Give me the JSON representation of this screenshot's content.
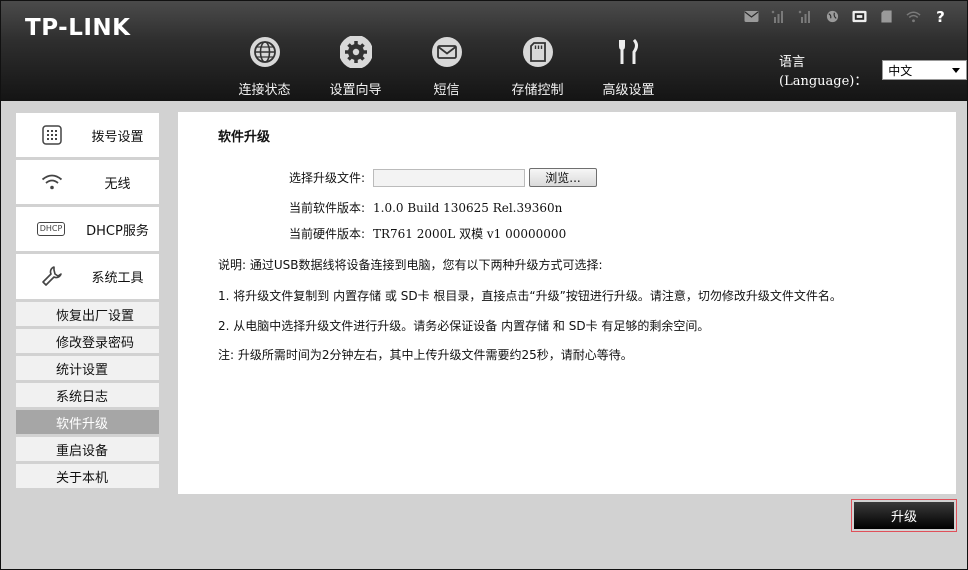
{
  "header": {
    "logo": "TP-LINK",
    "status_icons": [
      "mail-icon",
      "signal-icon",
      "signal-icon",
      "globe-icon",
      "sim-icon",
      "sd-card-icon",
      "wifi-icon",
      "help-icon"
    ],
    "help_glyph": "?",
    "nav": [
      {
        "label": "连接状态",
        "icon": "globe-icon"
      },
      {
        "label": "设置向导",
        "icon": "gear-icon"
      },
      {
        "label": "短信",
        "icon": "envelope-icon"
      },
      {
        "label": "存储控制",
        "icon": "sd-card-icon"
      },
      {
        "label": "高级设置",
        "icon": "tools-icon"
      }
    ],
    "language_label": "语言(Language)：",
    "language_value": "中文"
  },
  "sidebar": {
    "items": [
      {
        "label": "拨号设置",
        "icon": "dialpad-icon"
      },
      {
        "label": "无线",
        "icon": "wifi-icon"
      },
      {
        "label": "DHCP服务",
        "icon": "dhcp-icon",
        "icon_text": "DHCP"
      },
      {
        "label": "系统工具",
        "icon": "wrench-icon"
      }
    ],
    "sub_items": [
      "恢复出厂设置",
      "修改登录密码",
      "统计设置",
      "系统日志",
      "软件升级",
      "重启设备",
      "关于本机"
    ],
    "active_sub": "软件升级"
  },
  "main": {
    "title": "软件升级",
    "select_file_label": "选择升级文件:",
    "file_value": "",
    "browse_label": "浏览...",
    "software_version_label": "当前软件版本:",
    "software_version": "1.0.0 Build 130625 Rel.39360n",
    "hardware_version_label": "当前硬件版本:",
    "hardware_version": "TR761 2000L 双模  v1 00000000",
    "notes": [
      "说明: 通过USB数据线将设备连接到电脑，您有以下两种升级方式可选择:",
      "1. 将升级文件复制到  内置存储  或  SD卡  根目录，直接点击“升级”按钮进行升级。请注意，切勿修改升级文件文件名。",
      "2. 从电脑中选择升级文件进行升级。请务必保证设备  内置存储  和  SD卡  有足够的剩余空间。",
      "注: 升级所需时间为2分钟左右，其中上传升级文件需要约25秒，请耐心等待。"
    ]
  },
  "footer": {
    "upgrade_label": "升级"
  }
}
